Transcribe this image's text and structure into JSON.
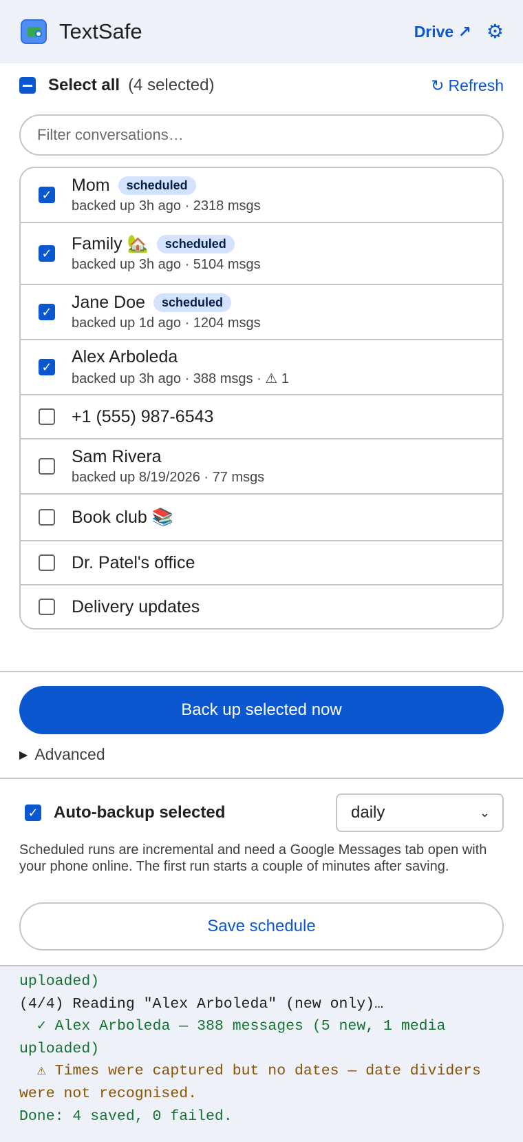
{
  "app": {
    "title": "TextSafe",
    "drive_label": "Drive ↗",
    "settings_icon": "gear-icon"
  },
  "selection": {
    "select_all_label": "Select all",
    "count_text": "(4 selected)",
    "refresh_label": "Refresh"
  },
  "filter": {
    "placeholder": "Filter conversations…",
    "value": ""
  },
  "conversations": [
    {
      "name": "Mom",
      "checked": true,
      "badge": "scheduled",
      "meta": "backed up 3h ago · 2318 msgs"
    },
    {
      "name": "Family 🏡",
      "checked": true,
      "badge": "scheduled",
      "meta": "backed up 3h ago · 5104 msgs"
    },
    {
      "name": "Jane Doe",
      "checked": true,
      "badge": "scheduled",
      "meta": "backed up 1d ago · 1204 msgs"
    },
    {
      "name": "Alex Arboleda",
      "checked": true,
      "badge": "",
      "meta": "backed up 3h ago · 388 msgs · ⚠ 1"
    },
    {
      "name": "+1 (555) 987-6543",
      "checked": false,
      "badge": "",
      "meta": ""
    },
    {
      "name": "Sam Rivera",
      "checked": false,
      "badge": "",
      "meta": "backed up 8/19/2026 · 77 msgs"
    },
    {
      "name": "Book club 📚",
      "checked": false,
      "badge": "",
      "meta": ""
    },
    {
      "name": "Dr. Patel's office",
      "checked": false,
      "badge": "",
      "meta": ""
    },
    {
      "name": "Delivery updates",
      "checked": false,
      "badge": "",
      "meta": ""
    }
  ],
  "actions": {
    "backup_now_label": "Back up selected now",
    "advanced_label": "Advanced"
  },
  "schedule": {
    "auto_backup_label": "Auto-backup selected",
    "auto_backup_checked": true,
    "frequency": "daily",
    "note": "Scheduled runs are incremental and need a Google Messages tab open with your phone online. The first run starts a couple of minutes after saving.",
    "save_label": "Save schedule"
  },
  "log": [
    {
      "kind": "ok",
      "text": "uploaded)"
    },
    {
      "kind": "info",
      "text": "(4/4) Reading \"Alex Arboleda\" (new only)…"
    },
    {
      "kind": "ok",
      "text": "  ✓ Alex Arboleda — 388 messages (5 new, 1 media uploaded)"
    },
    {
      "kind": "warn",
      "text": "  ⚠ Times were captured but no dates — date dividers were not recognised."
    },
    {
      "kind": "ok",
      "text": "Done: 4 saved, 0 failed."
    }
  ],
  "colors": {
    "accent": "#0b57d0",
    "badge_bg": "#d3e3fd",
    "log_ok": "#137333",
    "log_warn": "#8a5300",
    "header_bg": "#eef2f8"
  }
}
